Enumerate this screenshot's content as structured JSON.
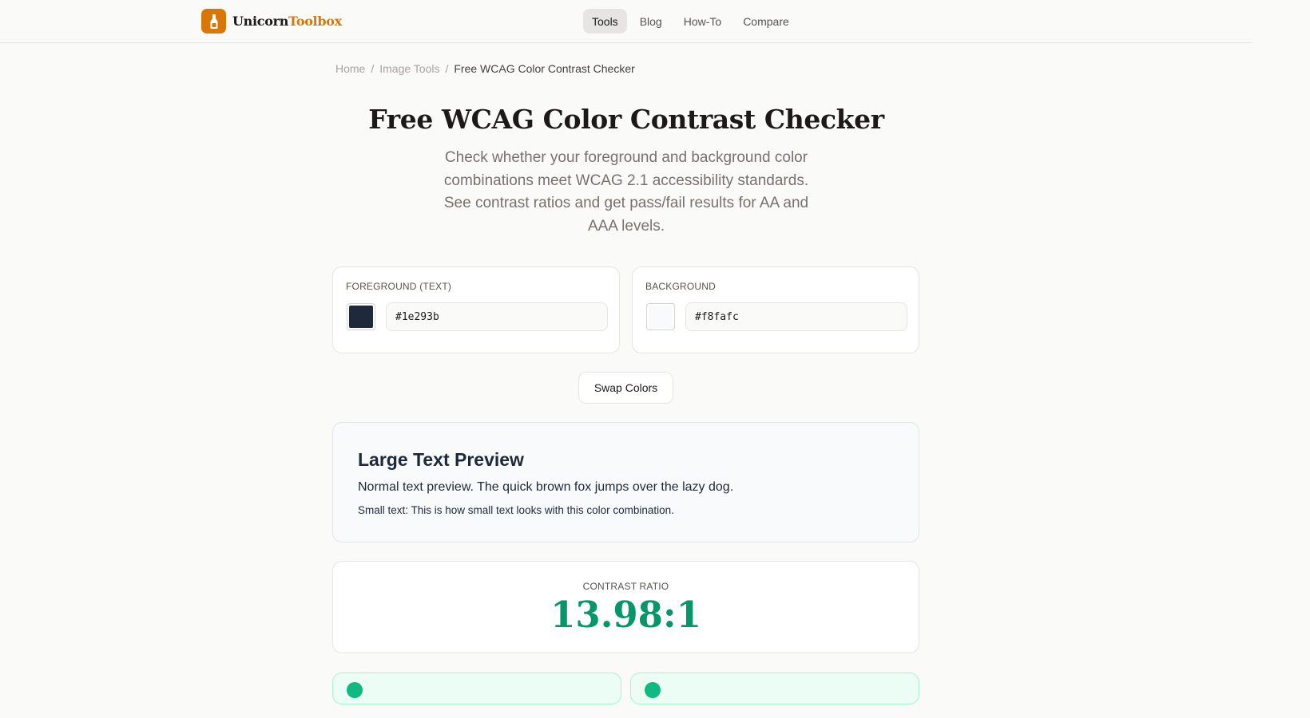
{
  "brand": {
    "name_part1": "Unicorn",
    "name_part2": "Toolbox",
    "accent": "#d97706"
  },
  "nav": {
    "items": [
      {
        "label": "Tools",
        "active": true
      },
      {
        "label": "Blog",
        "active": false
      },
      {
        "label": "How-To",
        "active": false
      },
      {
        "label": "Compare",
        "active": false
      }
    ]
  },
  "breadcrumb": {
    "home": "Home",
    "section": "Image Tools",
    "current": "Free WCAG Color Contrast Checker"
  },
  "page": {
    "title": "Free WCAG Color Contrast Checker",
    "subtitle": "Check whether your foreground and background color combinations meet WCAG 2.1 accessibility standards. See contrast ratios and get pass/fail results for AA and AAA levels."
  },
  "foreground": {
    "label": "FOREGROUND (TEXT)",
    "value": "#1e293b",
    "color": "#1e293b"
  },
  "background": {
    "label": "BACKGROUND",
    "value": "#f8fafc",
    "color": "#f8fafc"
  },
  "swap_label": "Swap Colors",
  "preview": {
    "large": "Large Text Preview",
    "normal": "Normal text preview. The quick brown fox jumps over the lazy dog.",
    "small": "Small text: This is how small text looks with this color combination."
  },
  "contrast": {
    "label": "CONTRAST RATIO",
    "value": "13.98:1",
    "color": "#059669"
  },
  "results": {
    "pass_color": "#10b981"
  }
}
